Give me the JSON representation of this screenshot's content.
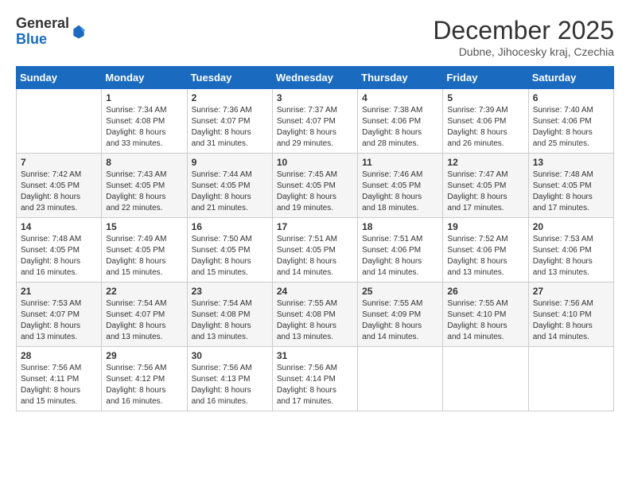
{
  "logo": {
    "general": "General",
    "blue": "Blue"
  },
  "title": "December 2025",
  "subtitle": "Dubne, Jihocesky kraj, Czechia",
  "days_of_week": [
    "Sunday",
    "Monday",
    "Tuesday",
    "Wednesday",
    "Thursday",
    "Friday",
    "Saturday"
  ],
  "weeks": [
    [
      {
        "day": "",
        "info": ""
      },
      {
        "day": "1",
        "info": "Sunrise: 7:34 AM\nSunset: 4:08 PM\nDaylight: 8 hours\nand 33 minutes."
      },
      {
        "day": "2",
        "info": "Sunrise: 7:36 AM\nSunset: 4:07 PM\nDaylight: 8 hours\nand 31 minutes."
      },
      {
        "day": "3",
        "info": "Sunrise: 7:37 AM\nSunset: 4:07 PM\nDaylight: 8 hours\nand 29 minutes."
      },
      {
        "day": "4",
        "info": "Sunrise: 7:38 AM\nSunset: 4:06 PM\nDaylight: 8 hours\nand 28 minutes."
      },
      {
        "day": "5",
        "info": "Sunrise: 7:39 AM\nSunset: 4:06 PM\nDaylight: 8 hours\nand 26 minutes."
      },
      {
        "day": "6",
        "info": "Sunrise: 7:40 AM\nSunset: 4:06 PM\nDaylight: 8 hours\nand 25 minutes."
      }
    ],
    [
      {
        "day": "7",
        "info": "Sunrise: 7:42 AM\nSunset: 4:05 PM\nDaylight: 8 hours\nand 23 minutes."
      },
      {
        "day": "8",
        "info": "Sunrise: 7:43 AM\nSunset: 4:05 PM\nDaylight: 8 hours\nand 22 minutes."
      },
      {
        "day": "9",
        "info": "Sunrise: 7:44 AM\nSunset: 4:05 PM\nDaylight: 8 hours\nand 21 minutes."
      },
      {
        "day": "10",
        "info": "Sunrise: 7:45 AM\nSunset: 4:05 PM\nDaylight: 8 hours\nand 19 minutes."
      },
      {
        "day": "11",
        "info": "Sunrise: 7:46 AM\nSunset: 4:05 PM\nDaylight: 8 hours\nand 18 minutes."
      },
      {
        "day": "12",
        "info": "Sunrise: 7:47 AM\nSunset: 4:05 PM\nDaylight: 8 hours\nand 17 minutes."
      },
      {
        "day": "13",
        "info": "Sunrise: 7:48 AM\nSunset: 4:05 PM\nDaylight: 8 hours\nand 17 minutes."
      }
    ],
    [
      {
        "day": "14",
        "info": "Sunrise: 7:48 AM\nSunset: 4:05 PM\nDaylight: 8 hours\nand 16 minutes."
      },
      {
        "day": "15",
        "info": "Sunrise: 7:49 AM\nSunset: 4:05 PM\nDaylight: 8 hours\nand 15 minutes."
      },
      {
        "day": "16",
        "info": "Sunrise: 7:50 AM\nSunset: 4:05 PM\nDaylight: 8 hours\nand 15 minutes."
      },
      {
        "day": "17",
        "info": "Sunrise: 7:51 AM\nSunset: 4:05 PM\nDaylight: 8 hours\nand 14 minutes."
      },
      {
        "day": "18",
        "info": "Sunrise: 7:51 AM\nSunset: 4:06 PM\nDaylight: 8 hours\nand 14 minutes."
      },
      {
        "day": "19",
        "info": "Sunrise: 7:52 AM\nSunset: 4:06 PM\nDaylight: 8 hours\nand 13 minutes."
      },
      {
        "day": "20",
        "info": "Sunrise: 7:53 AM\nSunset: 4:06 PM\nDaylight: 8 hours\nand 13 minutes."
      }
    ],
    [
      {
        "day": "21",
        "info": "Sunrise: 7:53 AM\nSunset: 4:07 PM\nDaylight: 8 hours\nand 13 minutes."
      },
      {
        "day": "22",
        "info": "Sunrise: 7:54 AM\nSunset: 4:07 PM\nDaylight: 8 hours\nand 13 minutes."
      },
      {
        "day": "23",
        "info": "Sunrise: 7:54 AM\nSunset: 4:08 PM\nDaylight: 8 hours\nand 13 minutes."
      },
      {
        "day": "24",
        "info": "Sunrise: 7:55 AM\nSunset: 4:08 PM\nDaylight: 8 hours\nand 13 minutes."
      },
      {
        "day": "25",
        "info": "Sunrise: 7:55 AM\nSunset: 4:09 PM\nDaylight: 8 hours\nand 14 minutes."
      },
      {
        "day": "26",
        "info": "Sunrise: 7:55 AM\nSunset: 4:10 PM\nDaylight: 8 hours\nand 14 minutes."
      },
      {
        "day": "27",
        "info": "Sunrise: 7:56 AM\nSunset: 4:10 PM\nDaylight: 8 hours\nand 14 minutes."
      }
    ],
    [
      {
        "day": "28",
        "info": "Sunrise: 7:56 AM\nSunset: 4:11 PM\nDaylight: 8 hours\nand 15 minutes."
      },
      {
        "day": "29",
        "info": "Sunrise: 7:56 AM\nSunset: 4:12 PM\nDaylight: 8 hours\nand 16 minutes."
      },
      {
        "day": "30",
        "info": "Sunrise: 7:56 AM\nSunset: 4:13 PM\nDaylight: 8 hours\nand 16 minutes."
      },
      {
        "day": "31",
        "info": "Sunrise: 7:56 AM\nSunset: 4:14 PM\nDaylight: 8 hours\nand 17 minutes."
      },
      {
        "day": "",
        "info": ""
      },
      {
        "day": "",
        "info": ""
      },
      {
        "day": "",
        "info": ""
      }
    ]
  ]
}
